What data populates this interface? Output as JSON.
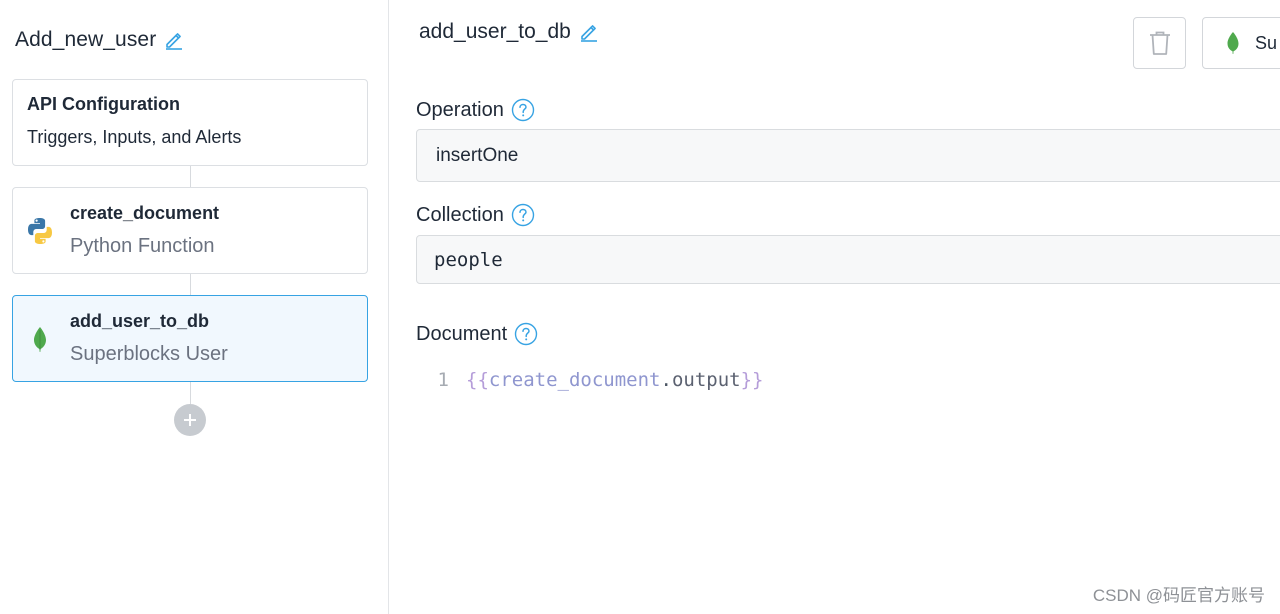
{
  "sidebar": {
    "api_title": "Add_new_user",
    "config_card": {
      "title": "API Configuration",
      "subtitle": "Triggers, Inputs, and Alerts"
    },
    "steps": [
      {
        "title": "create_document",
        "subtitle": "Python Function",
        "icon": "python-icon"
      },
      {
        "title": "add_user_to_db",
        "subtitle": "Superblocks User",
        "icon": "mongodb-leaf-icon"
      }
    ]
  },
  "main": {
    "step_name": "add_user_to_db",
    "integration_button_label": "Su",
    "operation": {
      "label": "Operation",
      "value": "insertOne"
    },
    "collection": {
      "label": "Collection",
      "value": "people"
    },
    "document": {
      "label": "Document",
      "line_number": "1",
      "code": {
        "open": "{{",
        "ident": "create_document",
        "dot": ".",
        "prop": "output",
        "close": "}}"
      }
    }
  },
  "watermark": "CSDN @码匠官方账号",
  "colors": {
    "accent": "#37a3e3",
    "selected_bg": "#f1f8fe",
    "mongo_green": "#4fa94d",
    "python_blue": "#3b77a8",
    "python_yellow": "#f7c843"
  }
}
